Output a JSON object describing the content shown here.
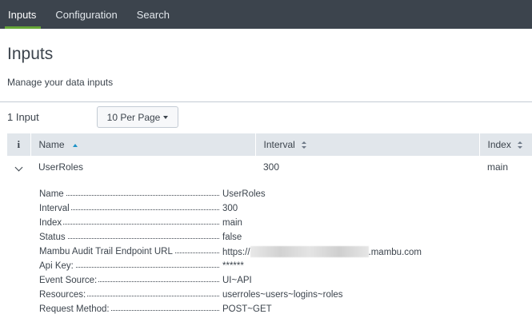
{
  "nav": {
    "tabs": [
      {
        "label": "Inputs",
        "active": true
      },
      {
        "label": "Configuration",
        "active": false
      },
      {
        "label": "Search",
        "active": false
      }
    ]
  },
  "page": {
    "title": "Inputs",
    "description": "Manage your data inputs"
  },
  "toolbar": {
    "count_label": "1 Input",
    "per_page_label": "10 Per Page"
  },
  "table": {
    "columns": {
      "info": "i",
      "name": "Name",
      "interval": "Interval",
      "index": "Index"
    },
    "rows": [
      {
        "name": "UserRoles",
        "interval": "300",
        "index": "main",
        "expanded": true
      }
    ]
  },
  "details": [
    {
      "label": "Name",
      "value": "UserRoles"
    },
    {
      "label": "Interval",
      "value": "300"
    },
    {
      "label": "Index",
      "value": "main"
    },
    {
      "label": "Status",
      "value": "false"
    },
    {
      "label": "Mambu Audit Trail Endpoint URL",
      "value_prefix": "https://",
      "value_suffix": ".mambu.com"
    },
    {
      "label": "Api Key:",
      "value": "******"
    },
    {
      "label": "Event Source:",
      "value": "UI~API"
    },
    {
      "label": "Resources:",
      "value": "userroles~users~logins~roles"
    },
    {
      "label": "Request Method:",
      "value": "POST~GET"
    }
  ],
  "colors": {
    "nav_bg": "#3c444d",
    "active_tab_underline": "#65a637",
    "header_bg": "#e1e6eb",
    "sort_active": "#1e93c6"
  }
}
